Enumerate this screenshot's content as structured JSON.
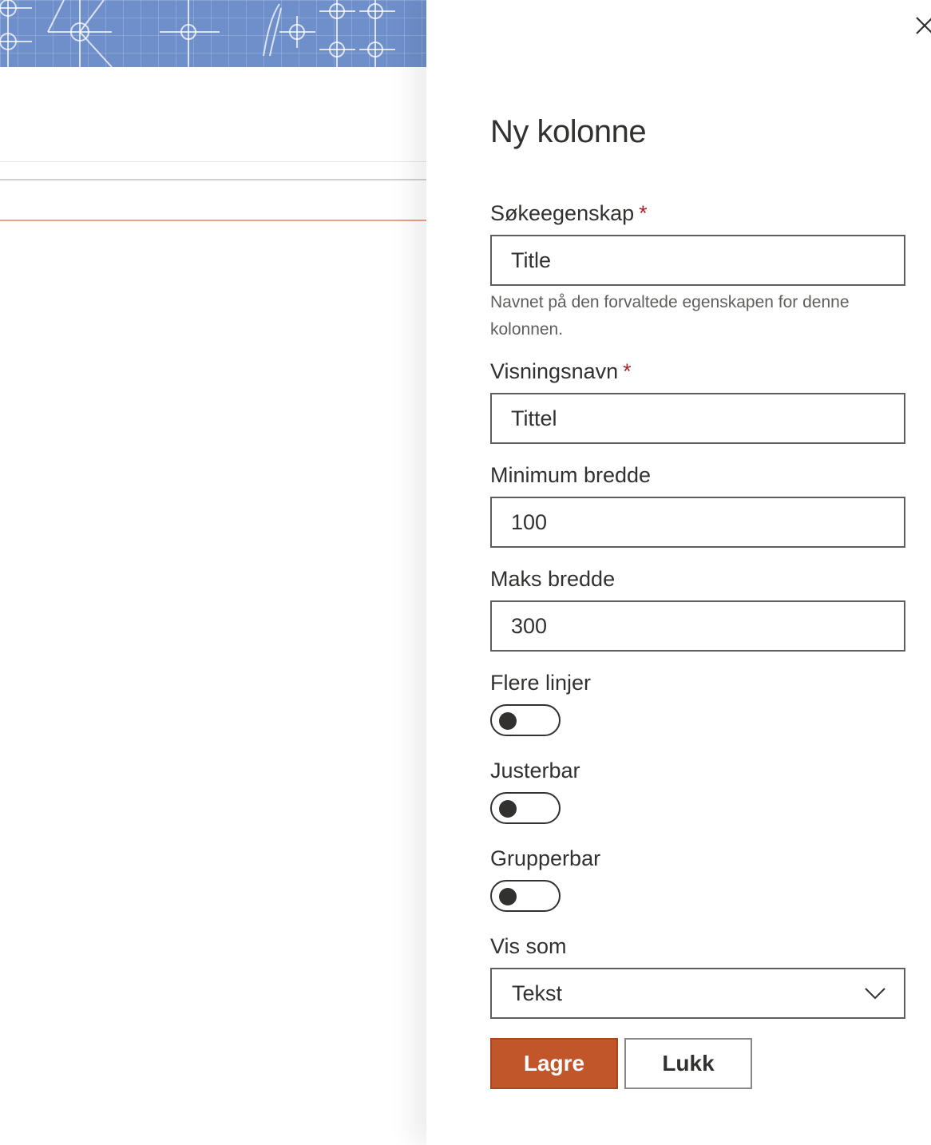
{
  "panel": {
    "title": "Ny kolonne",
    "close_icon": "close-icon"
  },
  "fields": {
    "search_property": {
      "label": "Søkeegenskap",
      "required_marker": "*",
      "value": "Title",
      "help": "Navnet på den forvaltede egenskapen for denne kolonnen."
    },
    "display_name": {
      "label": "Visningsnavn",
      "required_marker": "*",
      "value": "Tittel"
    },
    "min_width": {
      "label": "Minimum bredde",
      "value": "100"
    },
    "max_width": {
      "label": "Maks bredde",
      "value": "300"
    },
    "multiline": {
      "label": "Flere linjer",
      "checked": false
    },
    "resizable": {
      "label": "Justerbar",
      "checked": false
    },
    "groupable": {
      "label": "Grupperbar",
      "checked": false
    },
    "render_as": {
      "label": "Vis som",
      "selected": "Tekst"
    }
  },
  "buttons": {
    "save": "Lagre",
    "close": "Lukk"
  },
  "colors": {
    "primary": "#c1562a",
    "required": "#a4262c",
    "banner": "#6f8fcb"
  }
}
